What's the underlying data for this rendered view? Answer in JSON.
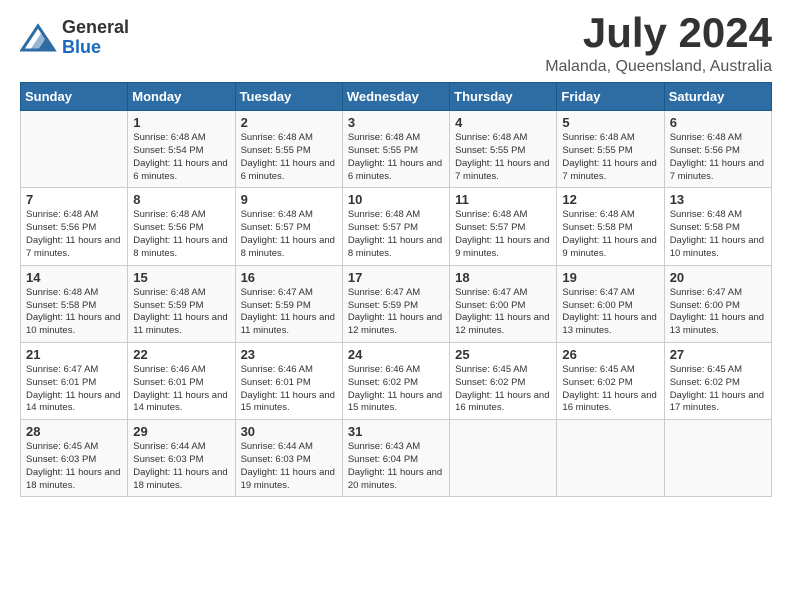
{
  "header": {
    "logo_general": "General",
    "logo_blue": "Blue",
    "month": "July 2024",
    "location": "Malanda, Queensland, Australia"
  },
  "columns": [
    "Sunday",
    "Monday",
    "Tuesday",
    "Wednesday",
    "Thursday",
    "Friday",
    "Saturday"
  ],
  "weeks": [
    [
      {
        "day": "",
        "sunrise": "",
        "sunset": "",
        "daylight": ""
      },
      {
        "day": "1",
        "sunrise": "Sunrise: 6:48 AM",
        "sunset": "Sunset: 5:54 PM",
        "daylight": "Daylight: 11 hours and 6 minutes."
      },
      {
        "day": "2",
        "sunrise": "Sunrise: 6:48 AM",
        "sunset": "Sunset: 5:55 PM",
        "daylight": "Daylight: 11 hours and 6 minutes."
      },
      {
        "day": "3",
        "sunrise": "Sunrise: 6:48 AM",
        "sunset": "Sunset: 5:55 PM",
        "daylight": "Daylight: 11 hours and 6 minutes."
      },
      {
        "day": "4",
        "sunrise": "Sunrise: 6:48 AM",
        "sunset": "Sunset: 5:55 PM",
        "daylight": "Daylight: 11 hours and 7 minutes."
      },
      {
        "day": "5",
        "sunrise": "Sunrise: 6:48 AM",
        "sunset": "Sunset: 5:55 PM",
        "daylight": "Daylight: 11 hours and 7 minutes."
      },
      {
        "day": "6",
        "sunrise": "Sunrise: 6:48 AM",
        "sunset": "Sunset: 5:56 PM",
        "daylight": "Daylight: 11 hours and 7 minutes."
      }
    ],
    [
      {
        "day": "7",
        "sunrise": "Sunrise: 6:48 AM",
        "sunset": "Sunset: 5:56 PM",
        "daylight": "Daylight: 11 hours and 7 minutes."
      },
      {
        "day": "8",
        "sunrise": "Sunrise: 6:48 AM",
        "sunset": "Sunset: 5:56 PM",
        "daylight": "Daylight: 11 hours and 8 minutes."
      },
      {
        "day": "9",
        "sunrise": "Sunrise: 6:48 AM",
        "sunset": "Sunset: 5:57 PM",
        "daylight": "Daylight: 11 hours and 8 minutes."
      },
      {
        "day": "10",
        "sunrise": "Sunrise: 6:48 AM",
        "sunset": "Sunset: 5:57 PM",
        "daylight": "Daylight: 11 hours and 8 minutes."
      },
      {
        "day": "11",
        "sunrise": "Sunrise: 6:48 AM",
        "sunset": "Sunset: 5:57 PM",
        "daylight": "Daylight: 11 hours and 9 minutes."
      },
      {
        "day": "12",
        "sunrise": "Sunrise: 6:48 AM",
        "sunset": "Sunset: 5:58 PM",
        "daylight": "Daylight: 11 hours and 9 minutes."
      },
      {
        "day": "13",
        "sunrise": "Sunrise: 6:48 AM",
        "sunset": "Sunset: 5:58 PM",
        "daylight": "Daylight: 11 hours and 10 minutes."
      }
    ],
    [
      {
        "day": "14",
        "sunrise": "Sunrise: 6:48 AM",
        "sunset": "Sunset: 5:58 PM",
        "daylight": "Daylight: 11 hours and 10 minutes."
      },
      {
        "day": "15",
        "sunrise": "Sunrise: 6:48 AM",
        "sunset": "Sunset: 5:59 PM",
        "daylight": "Daylight: 11 hours and 11 minutes."
      },
      {
        "day": "16",
        "sunrise": "Sunrise: 6:47 AM",
        "sunset": "Sunset: 5:59 PM",
        "daylight": "Daylight: 11 hours and 11 minutes."
      },
      {
        "day": "17",
        "sunrise": "Sunrise: 6:47 AM",
        "sunset": "Sunset: 5:59 PM",
        "daylight": "Daylight: 11 hours and 12 minutes."
      },
      {
        "day": "18",
        "sunrise": "Sunrise: 6:47 AM",
        "sunset": "Sunset: 6:00 PM",
        "daylight": "Daylight: 11 hours and 12 minutes."
      },
      {
        "day": "19",
        "sunrise": "Sunrise: 6:47 AM",
        "sunset": "Sunset: 6:00 PM",
        "daylight": "Daylight: 11 hours and 13 minutes."
      },
      {
        "day": "20",
        "sunrise": "Sunrise: 6:47 AM",
        "sunset": "Sunset: 6:00 PM",
        "daylight": "Daylight: 11 hours and 13 minutes."
      }
    ],
    [
      {
        "day": "21",
        "sunrise": "Sunrise: 6:47 AM",
        "sunset": "Sunset: 6:01 PM",
        "daylight": "Daylight: 11 hours and 14 minutes."
      },
      {
        "day": "22",
        "sunrise": "Sunrise: 6:46 AM",
        "sunset": "Sunset: 6:01 PM",
        "daylight": "Daylight: 11 hours and 14 minutes."
      },
      {
        "day": "23",
        "sunrise": "Sunrise: 6:46 AM",
        "sunset": "Sunset: 6:01 PM",
        "daylight": "Daylight: 11 hours and 15 minutes."
      },
      {
        "day": "24",
        "sunrise": "Sunrise: 6:46 AM",
        "sunset": "Sunset: 6:02 PM",
        "daylight": "Daylight: 11 hours and 15 minutes."
      },
      {
        "day": "25",
        "sunrise": "Sunrise: 6:45 AM",
        "sunset": "Sunset: 6:02 PM",
        "daylight": "Daylight: 11 hours and 16 minutes."
      },
      {
        "day": "26",
        "sunrise": "Sunrise: 6:45 AM",
        "sunset": "Sunset: 6:02 PM",
        "daylight": "Daylight: 11 hours and 16 minutes."
      },
      {
        "day": "27",
        "sunrise": "Sunrise: 6:45 AM",
        "sunset": "Sunset: 6:02 PM",
        "daylight": "Daylight: 11 hours and 17 minutes."
      }
    ],
    [
      {
        "day": "28",
        "sunrise": "Sunrise: 6:45 AM",
        "sunset": "Sunset: 6:03 PM",
        "daylight": "Daylight: 11 hours and 18 minutes."
      },
      {
        "day": "29",
        "sunrise": "Sunrise: 6:44 AM",
        "sunset": "Sunset: 6:03 PM",
        "daylight": "Daylight: 11 hours and 18 minutes."
      },
      {
        "day": "30",
        "sunrise": "Sunrise: 6:44 AM",
        "sunset": "Sunset: 6:03 PM",
        "daylight": "Daylight: 11 hours and 19 minutes."
      },
      {
        "day": "31",
        "sunrise": "Sunrise: 6:43 AM",
        "sunset": "Sunset: 6:04 PM",
        "daylight": "Daylight: 11 hours and 20 minutes."
      },
      {
        "day": "",
        "sunrise": "",
        "sunset": "",
        "daylight": ""
      },
      {
        "day": "",
        "sunrise": "",
        "sunset": "",
        "daylight": ""
      },
      {
        "day": "",
        "sunrise": "",
        "sunset": "",
        "daylight": ""
      }
    ]
  ]
}
